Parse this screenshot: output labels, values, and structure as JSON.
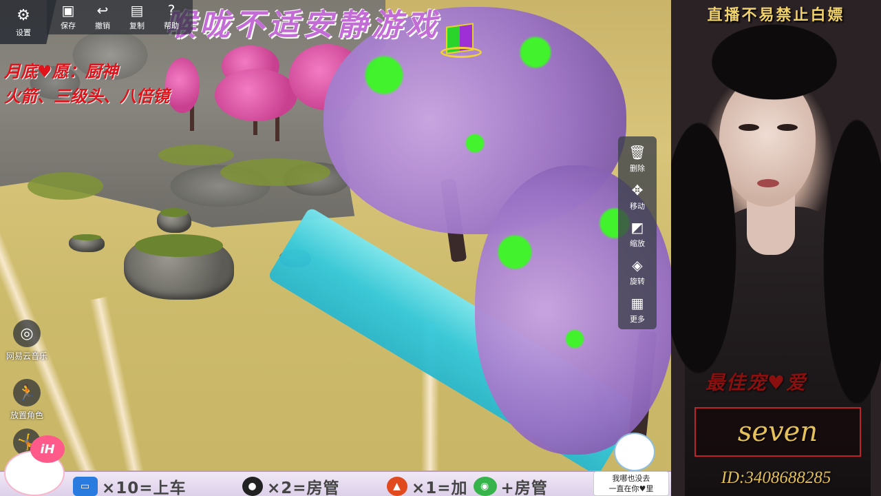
{
  "banner": "喉咙不适安静游戏",
  "notes": {
    "line1": "月底♥愿：厨神",
    "line2": "火箭、三级头、八倍镜"
  },
  "toolbar": {
    "settings": "设置",
    "save": "保存",
    "undo": "撤销",
    "copy": "复制",
    "help": "帮助"
  },
  "tools": {
    "delete": "删除",
    "move": "移动",
    "scale": "缩放",
    "rotate": "旋转",
    "more": "更多"
  },
  "left_buttons": {
    "music": "网易云音乐",
    "place_character": "放置角色"
  },
  "bottom": {
    "item1": "×10=上车",
    "item2": "×2=房管",
    "item3": "×1=加",
    "item4": "+房管",
    "mascot_bubble": "iH",
    "cat_line1": "我哪也没去",
    "cat_line2": "一直在你♥里"
  },
  "stream": {
    "title": "直播不易禁止白嫖",
    "best_fan_label": "最佳宠♥爱",
    "best_fan_name": "seven",
    "id": "ID:3408688285"
  },
  "colors": {
    "banner": "#c36cd6",
    "note_red": "#e0121a",
    "gold": "#e5c15a",
    "river": "#35c9dc",
    "blossom_pink": "#e65aaf",
    "canopy_purple": "#9a72c6",
    "leaf_green": "#3cf52a"
  }
}
